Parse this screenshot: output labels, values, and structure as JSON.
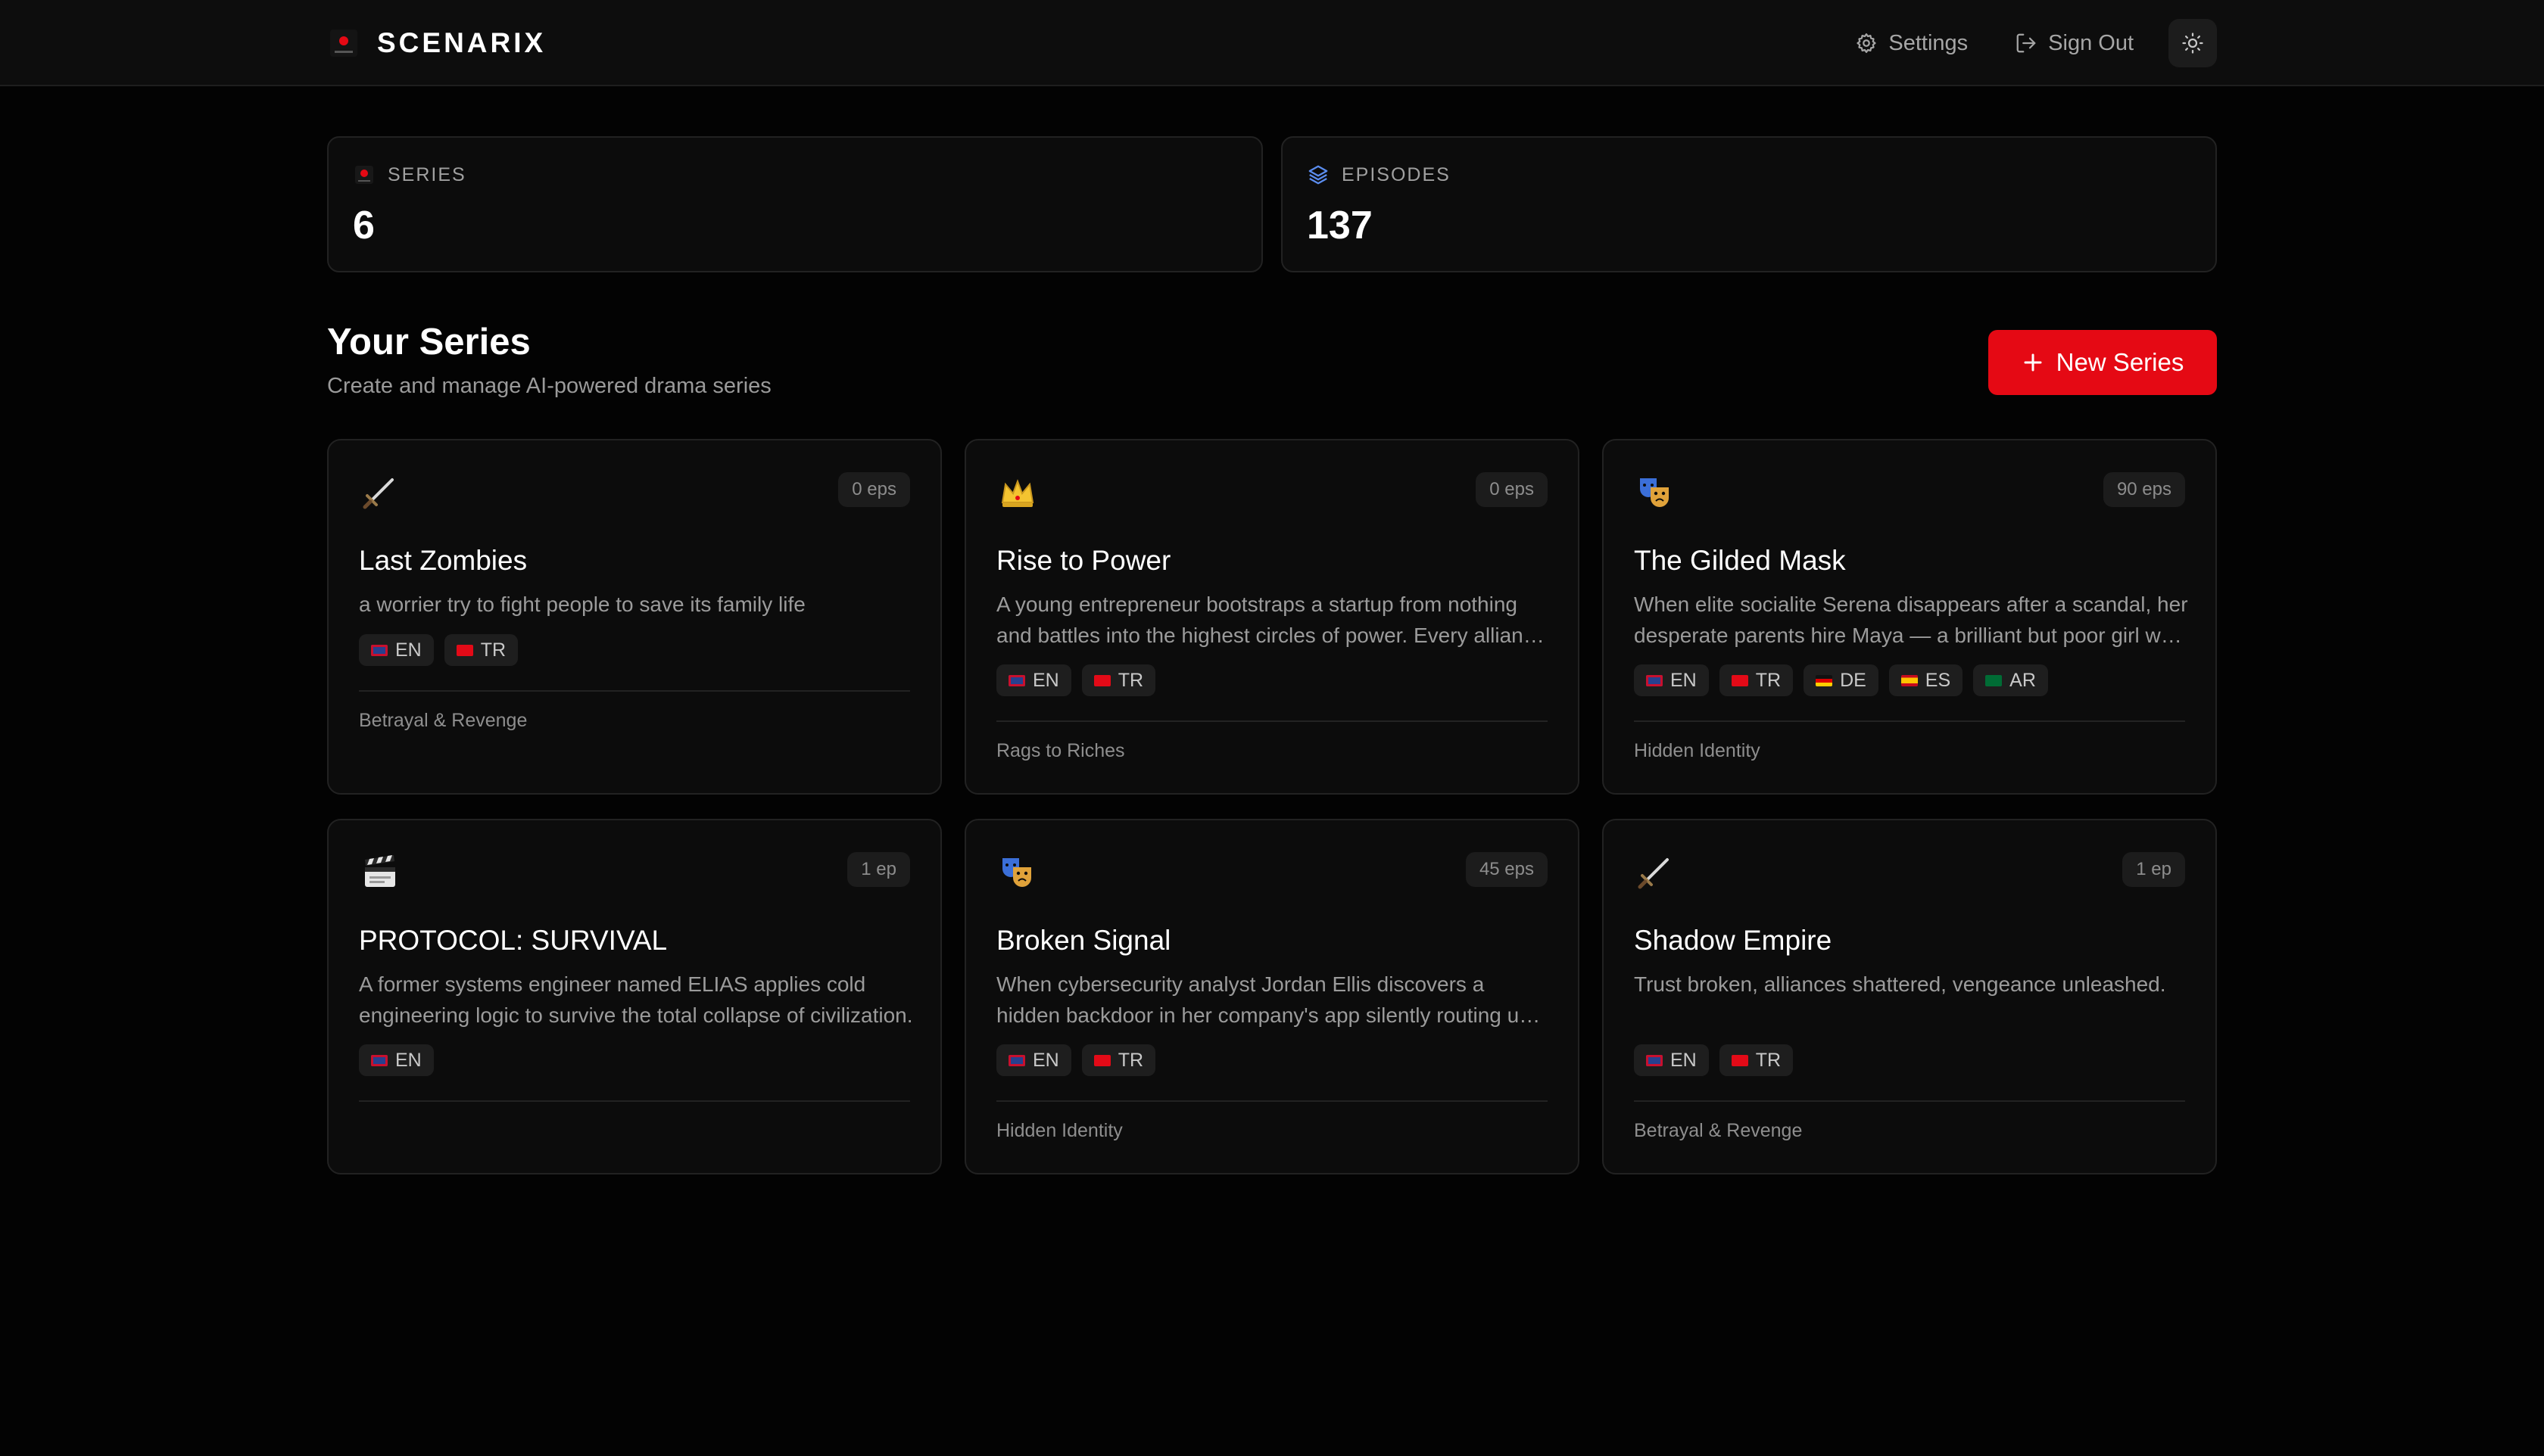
{
  "app": {
    "name": "SCENARIX"
  },
  "nav": {
    "settings_label": "Settings",
    "signout_label": "Sign Out"
  },
  "stats": [
    {
      "label": "SERIES",
      "value": "6",
      "icon": "film-icon"
    },
    {
      "label": "EPISODES",
      "value": "137",
      "icon": "layers-icon"
    }
  ],
  "section": {
    "title": "Your Series",
    "subtitle": "Create and manage AI-powered drama series",
    "new_button_label": "New Series"
  },
  "colors": {
    "accent": "#e50914",
    "background": "#030303",
    "card": "#0c0c0c",
    "badge": "#1e1e1e"
  },
  "series": [
    {
      "icon": "dagger-icon",
      "episodes": "0 eps",
      "title": "Last Zombies",
      "description": "a worrier try to fight people to save its family life",
      "languages": [
        "EN",
        "TR"
      ],
      "genre": "Betrayal & Revenge"
    },
    {
      "icon": "crown-icon",
      "episodes": "0 eps",
      "title": "Rise to Power",
      "description": "A young entrepreneur bootstraps a startup from nothing and battles into the highest circles of power. Every alliance has a price, every victory invites new enemies.",
      "languages": [
        "EN",
        "TR"
      ],
      "genre": "Rags to Riches"
    },
    {
      "icon": "theater-masks-icon",
      "episodes": "90 eps",
      "title": "The Gilded Mask",
      "description": "When elite socialite Serena disappears after a scandal, her desperate parents hire Maya — a brilliant but poor girl who looks exactly like her.",
      "languages": [
        "EN",
        "TR",
        "DE",
        "ES",
        "AR"
      ],
      "genre": "Hidden Identity"
    },
    {
      "icon": "clapperboard-icon",
      "episodes": "1 ep",
      "title": "PROTOCOL: SURVIVAL",
      "description": "A former systems engineer named ELIAS applies cold engineering logic to survive the total collapse of civilization.",
      "languages": [
        "EN"
      ],
      "genre": ""
    },
    {
      "icon": "theater-masks-icon",
      "episodes": "45 eps",
      "title": "Broken Signal",
      "description": "When cybersecurity analyst Jordan Ellis discovers a hidden backdoor in her company's app silently routing user data to an unknown server.",
      "languages": [
        "EN",
        "TR"
      ],
      "genre": "Hidden Identity"
    },
    {
      "icon": "dagger-icon",
      "episodes": "1 ep",
      "title": "Shadow Empire",
      "description": "Trust broken, alliances shattered, vengeance unleashed.",
      "languages": [
        "EN",
        "TR"
      ],
      "genre": "Betrayal & Revenge"
    }
  ]
}
